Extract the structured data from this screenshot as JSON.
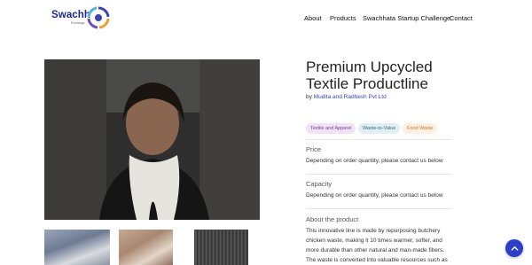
{
  "brand": {
    "name": "Swachh",
    "tagline": "Exchange"
  },
  "nav": {
    "about": "About",
    "products": "Products",
    "challenge": "Swachhata Startup Challenge",
    "contact": "Contact"
  },
  "product": {
    "title": "Premium Upcycled Textile Productline",
    "by_label": "by",
    "company": "Mudita and Radhesh Pvt Ltd",
    "tags": [
      "Textile and Apparel",
      "Waste-to-Value",
      "Food Waste"
    ],
    "price_title": "Price",
    "price_text": "Depending on order quantity, please contact us below",
    "capacity_title": "Capacity",
    "capacity_text": "Depending on order quantity, please contact us below",
    "about_title": "About the product",
    "about_text": "This innovative line is made by repurposing butchery chicken waste, making it 10 times warmer, softer, and more durable than other natural and man-made fibers. The waste is converted into valuable resources such as"
  },
  "colors": {
    "accent": "#2b3fc7",
    "link": "#3b3fc0"
  },
  "icons": {
    "scroll_top": "chevron-up-icon",
    "logo": "swirl-logo-icon"
  }
}
